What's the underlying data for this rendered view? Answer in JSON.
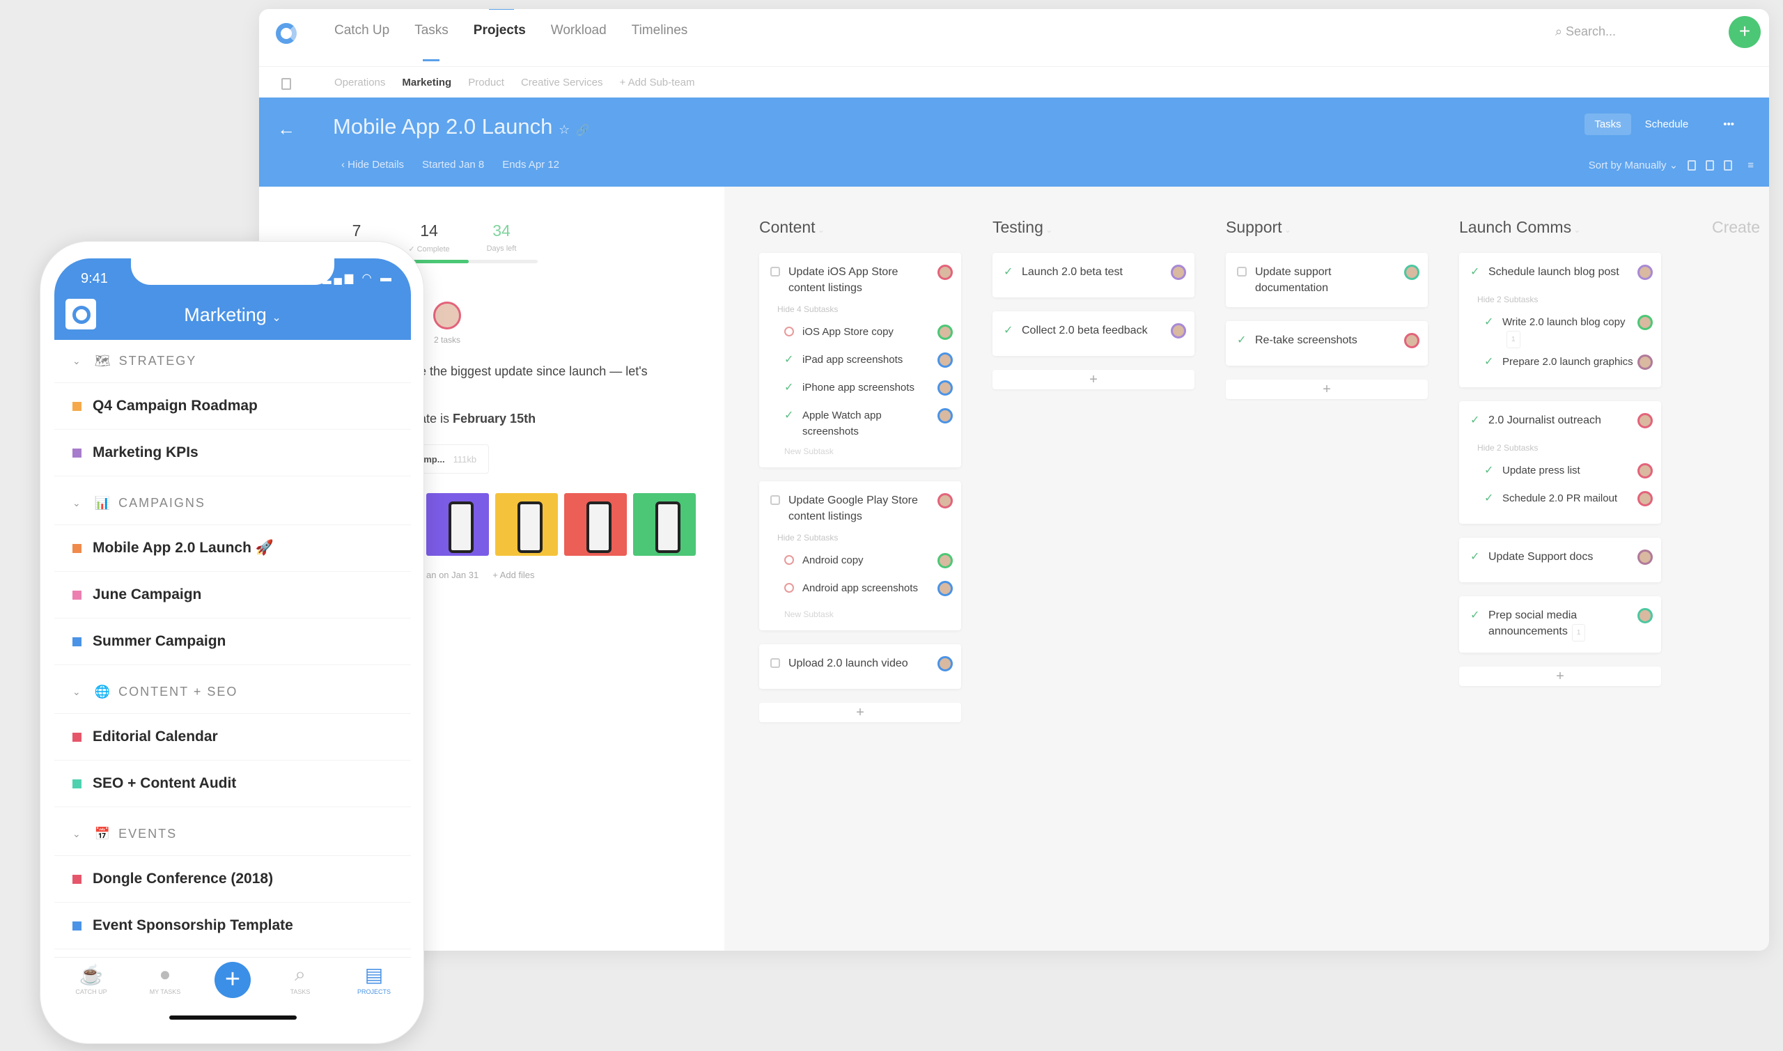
{
  "nav": {
    "items": [
      "Catch Up",
      "Tasks",
      "Projects",
      "Workload",
      "Timelines"
    ],
    "active": "Projects",
    "search_placeholder": "Search...",
    "add": "+"
  },
  "subnav": {
    "items": [
      "Operations",
      "Marketing",
      "Product",
      "Creative Services",
      "+ Add Sub-team"
    ],
    "active": "Marketing"
  },
  "project": {
    "title": "Mobile App 2.0 Launch",
    "hide_details": "Hide Details",
    "started": "Started Jan 8",
    "ends": "Ends Apr 12",
    "tabs": [
      "Tasks",
      "Schedule"
    ],
    "sort": "Sort by Manually",
    "accent": "#5ea4ee"
  },
  "details": {
    "stats": [
      {
        "n": "7",
        "l": ""
      },
      {
        "n": "14",
        "l": "✓ Complete"
      },
      {
        "n": "34",
        "l": "Days left"
      }
    ],
    "progress": 0.45,
    "owner_tasks": "2 tasks",
    "desc1": "e the biggest update since launch — let's",
    "desc2_a": "ate is ",
    "desc2_b": "February 15th",
    "file_name": "emp...",
    "file_size": "111kb",
    "thumb_colors": [
      "#7b5ce6",
      "#f5c33b",
      "#ec5f56",
      "#4cc776"
    ],
    "files_uploaded": "an on Jan 31",
    "add_files": "+ Add files"
  },
  "board": {
    "create": "Create",
    "columns": [
      {
        "title": "Content",
        "cards": [
          {
            "status": "box",
            "text": "Update iOS App Store content listings",
            "avatar": "#e3637a",
            "hide": "Hide 4 Subtasks",
            "new_subtask": "New Subtask",
            "subtasks": [
              {
                "status": "circ",
                "text": "iOS App Store copy",
                "avatar": "#4cc776"
              },
              {
                "status": "done",
                "text": "iPad app screenshots",
                "avatar": "#4a93e6"
              },
              {
                "status": "done",
                "text": "iPhone app screenshots",
                "avatar": "#4a93e6"
              },
              {
                "status": "done",
                "text": "Apple Watch app screenshots",
                "avatar": "#4a93e6"
              }
            ]
          },
          {
            "status": "box",
            "text": "Update Google Play Store content listings",
            "avatar": "#e3637a",
            "hide": "Hide 2 Subtasks",
            "new_subtask": "New Subtask",
            "subtasks": [
              {
                "status": "circ",
                "text": "Android copy",
                "avatar": "#4cc776"
              },
              {
                "status": "circ",
                "text": "Android app screenshots",
                "avatar": "#4a93e6"
              }
            ]
          },
          {
            "status": "box",
            "text": "Upload 2.0 launch video",
            "avatar": "#4a93e6"
          }
        ]
      },
      {
        "title": "Testing",
        "cards": [
          {
            "status": "done",
            "text": "Launch 2.0 beta test",
            "avatar": "#a889d6"
          },
          {
            "status": "done",
            "text": "Collect 2.0 beta feedback",
            "avatar": "#a889d6"
          }
        ]
      },
      {
        "title": "Support",
        "cards": [
          {
            "status": "box",
            "text": "Update support documentation",
            "avatar": "#4cc7a0"
          },
          {
            "status": "done",
            "text": "Re-take screenshots",
            "avatar": "#e3637a"
          }
        ]
      },
      {
        "title": "Launch Comms",
        "cards": [
          {
            "status": "done",
            "text": "Schedule launch blog post",
            "avatar": "#a889d6",
            "hide": "Hide 2 Subtasks",
            "subtasks": [
              {
                "status": "done",
                "text": "Write 2.0 launch blog copy",
                "avatar": "#4cc776",
                "count": "1"
              },
              {
                "status": "done",
                "text": "Prepare 2.0 launch graphics",
                "avatar": "#b07a9a"
              }
            ]
          },
          {
            "status": "done",
            "text": "2.0 Journalist outreach",
            "avatar": "#e3637a",
            "hide": "Hide 2 Subtasks",
            "subtasks": [
              {
                "status": "done",
                "text": "Update press list",
                "avatar": "#e3637a"
              },
              {
                "status": "done",
                "text": "Schedule 2.0 PR mailout",
                "avatar": "#e3637a"
              }
            ]
          },
          {
            "status": "done",
            "text": "Update Support docs",
            "avatar": "#b07a9a"
          },
          {
            "status": "done",
            "text": "Prep social media announcements",
            "avatar": "#4cc7a0",
            "count": "1"
          }
        ]
      }
    ]
  },
  "phone": {
    "time": "9:41",
    "title": "Marketing",
    "sections": [
      {
        "title": "STRATEGY",
        "emoji": "🗺",
        "items": [
          {
            "label": "Q4 Campaign Roadmap",
            "color": "#f5a94a"
          },
          {
            "label": "Marketing KPIs",
            "color": "#a77ccc"
          }
        ]
      },
      {
        "title": "CAMPAIGNS",
        "emoji": "📊",
        "items": [
          {
            "label": "Mobile App 2.0 Launch 🚀",
            "color": "#f08a4b"
          },
          {
            "label": "June Campaign",
            "color": "#ec7fb0"
          },
          {
            "label": "Summer Campaign",
            "color": "#4a93e6"
          }
        ]
      },
      {
        "title": "CONTENT + SEO",
        "emoji": "🌐",
        "items": [
          {
            "label": "Editorial Calendar",
            "color": "#e6566a"
          },
          {
            "label": "SEO + Content Audit",
            "color": "#4fd1b0"
          }
        ]
      },
      {
        "title": "EVENTS",
        "emoji": "📅",
        "items": [
          {
            "label": "Dongle Conference (2018)",
            "color": "#e6566a"
          },
          {
            "label": "Event Sponsorship Template",
            "color": "#4a93e6"
          }
        ]
      }
    ],
    "tabbar": [
      {
        "label": "CATCH UP",
        "icon": "cup-icon"
      },
      {
        "label": "MY TASKS",
        "icon": "avatar-icon"
      },
      {
        "label": "",
        "icon": "plus-icon"
      },
      {
        "label": "TASKS",
        "icon": "search-check-icon"
      },
      {
        "label": "PROJECTS",
        "icon": "projects-icon",
        "active": true
      }
    ]
  }
}
